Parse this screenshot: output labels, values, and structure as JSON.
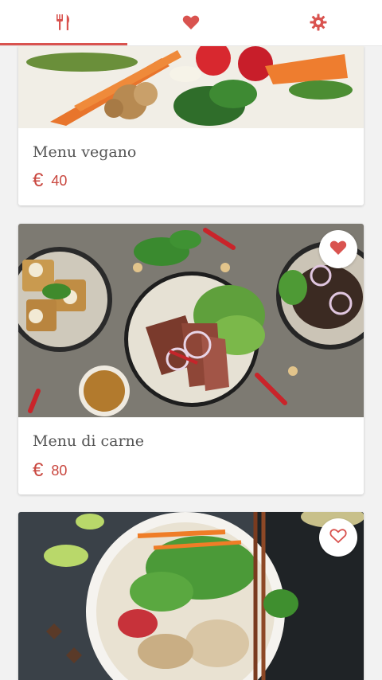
{
  "tabs": [
    {
      "name": "menu",
      "icon": "cutlery-icon",
      "active": true
    },
    {
      "name": "favorites",
      "icon": "heart-icon",
      "active": false
    },
    {
      "name": "settings",
      "icon": "gear-icon",
      "active": false
    }
  ],
  "accent_color": "#d9534f",
  "cards": [
    {
      "title": "Menu vegano",
      "currency": "€",
      "price": "40",
      "favorite": null
    },
    {
      "title": "Menu di carne",
      "currency": "€",
      "price": "80",
      "favorite": true
    },
    {
      "title": "",
      "currency": "",
      "price": "",
      "favorite": false
    }
  ]
}
